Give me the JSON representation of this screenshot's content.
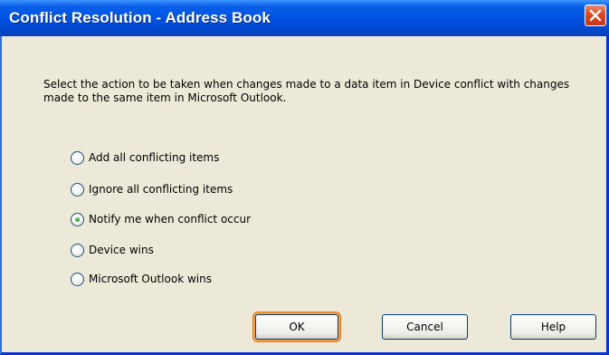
{
  "window": {
    "title": "Conflict Resolution - Address Book",
    "close_icon": "close-icon"
  },
  "prompt": "Select the action to be taken when changes made to a data item in Device conflict with changes made to the same item in Microsoft Outlook.",
  "options": [
    {
      "label": "Add all conflicting items",
      "checked": false
    },
    {
      "label": "Ignore all conflicting items",
      "checked": false
    },
    {
      "label": "Notify me when conflict occur",
      "checked": true
    },
    {
      "label": "Device wins",
      "checked": false
    },
    {
      "label": "Microsoft Outlook wins",
      "checked": false
    }
  ],
  "buttons": {
    "ok": "OK",
    "cancel": "Cancel",
    "help": "Help"
  },
  "colors": {
    "title_bar": "#0054e3",
    "dialog_bg": "#ece9d8",
    "default_button_ring": "#e3791f",
    "radio_selected": "#21a121"
  }
}
